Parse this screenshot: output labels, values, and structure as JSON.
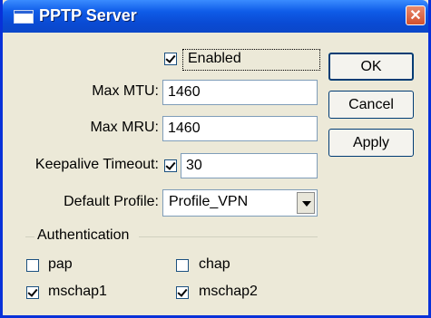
{
  "window": {
    "title": "PPTP Server",
    "close_glyph": "✕"
  },
  "form": {
    "enabled": {
      "label": "Enabled",
      "checked": true
    },
    "max_mtu": {
      "label": "Max MTU:",
      "value": "1460"
    },
    "max_mru": {
      "label": "Max MRU:",
      "value": "1460"
    },
    "keepalive": {
      "label": "Keepalive Timeout:",
      "checked": true,
      "value": "30"
    },
    "default_profile": {
      "label": "Default Profile:",
      "value": "Profile_VPN"
    }
  },
  "authentication": {
    "title": "Authentication",
    "options": [
      {
        "label": "pap",
        "checked": false
      },
      {
        "label": "chap",
        "checked": false
      },
      {
        "label": "mschap1",
        "checked": true
      },
      {
        "label": "mschap2",
        "checked": true
      }
    ]
  },
  "buttons": {
    "ok": "OK",
    "cancel": "Cancel",
    "apply": "Apply"
  },
  "icons": {
    "window": "window-app-icon",
    "close": "close-icon",
    "dropdown": "chevron-down-icon"
  }
}
